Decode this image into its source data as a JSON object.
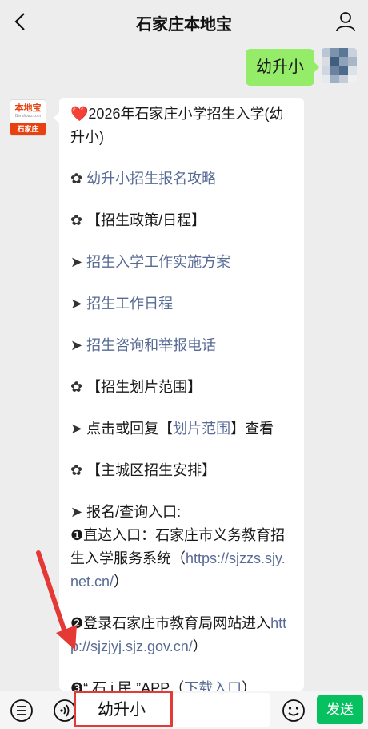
{
  "header": {
    "title": "石家庄本地宝"
  },
  "chat": {
    "user_message": "幼升小",
    "bot_avatar": {
      "logo_text": "本地宝",
      "site_text": "Bendibao.com",
      "city_text": "石家庄"
    },
    "bot_message": {
      "heading_icon": "❤️",
      "heading": "2026年石家庄小学招生入学(幼升小)",
      "flower": "✿",
      "arrow": "➤",
      "item_guide": "幼升小招生报名攻略",
      "section_policy": "【招生政策/日程】",
      "link_plan": "招生入学工作实施方案",
      "link_schedule": "招生工作日程",
      "link_phone": "招生咨询和举报电话",
      "section_zoning": "【招生划片范围】",
      "zoning_text_before": "点击或回复【",
      "zoning_link": "划片范围",
      "zoning_text_after": "】查看",
      "section_main": "【主城区招生安排】",
      "entry_title": "报名/查询入口:",
      "entry1_prefix": "❶直达入口：石家庄市义务教育招生入学服务系统（",
      "entry1_url": "https://sjzzs.sjy.net.cn/",
      "entry1_suffix": "）",
      "entry2_prefix": "❷登录石家庄市教育局网站进入",
      "entry2_url": "http://sjzjyj.sjz.gov.cn/",
      "entry2_suffix": "）",
      "entry3_prefix": "❸“ 石 i 民 ”APP（",
      "entry3_link": "下载入口",
      "entry3_suffix": "）"
    }
  },
  "input_bar": {
    "value": "幼升小",
    "send_label": "发送"
  },
  "colors": {
    "user_bubble": "#95ec69",
    "link": "#576b95",
    "send": "#07c160",
    "highlight": "#e53935"
  },
  "icons": [
    "back-icon",
    "person-icon",
    "menu-icon",
    "voice-icon",
    "emoji-icon"
  ]
}
